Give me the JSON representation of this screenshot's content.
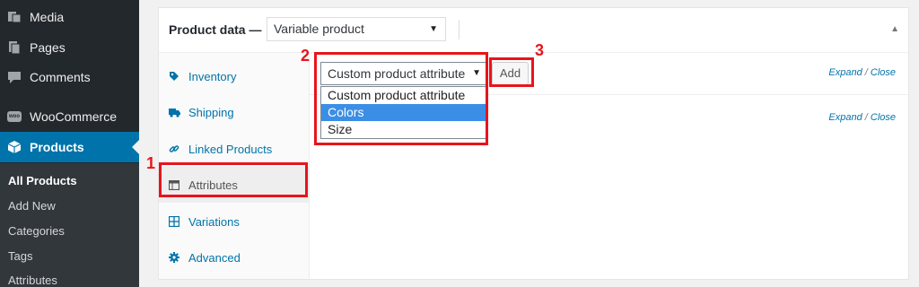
{
  "sidebar": {
    "menu": [
      {
        "label": "Media",
        "icon": "media-icon"
      },
      {
        "label": "Pages",
        "icon": "pages-icon"
      },
      {
        "label": "Comments",
        "icon": "comments-icon"
      },
      {
        "label": "WooCommerce",
        "icon": "woocommerce-icon",
        "badge": "woo"
      },
      {
        "label": "Products",
        "icon": "products-icon"
      }
    ],
    "submenu": [
      "All Products",
      "Add New",
      "Categories",
      "Tags",
      "Attributes"
    ]
  },
  "product_data": {
    "title": "Product data —",
    "type_value": "Variable product",
    "tabs": [
      {
        "label": "Inventory",
        "icon": "tag-icon"
      },
      {
        "label": "Shipping",
        "icon": "truck-icon"
      },
      {
        "label": "Linked Products",
        "icon": "link-icon"
      },
      {
        "label": "Attributes",
        "icon": "table-icon"
      },
      {
        "label": "Variations",
        "icon": "grid-icon"
      },
      {
        "label": "Advanced",
        "icon": "gear-icon"
      }
    ],
    "attribute_select": {
      "value": "Custom product attribute",
      "options": [
        "Custom product attribute",
        "Colors",
        "Size"
      ],
      "highlighted": "Colors"
    },
    "add_label": "Add",
    "expand": "Expand",
    "separator": "/",
    "close": "Close"
  },
  "annotations": [
    "1",
    "2",
    "3"
  ],
  "colors": {
    "accent": "#0073aa",
    "sidebar": "#23282d",
    "highlight": "#e8141b",
    "option_selected": "#3b8ee5"
  }
}
